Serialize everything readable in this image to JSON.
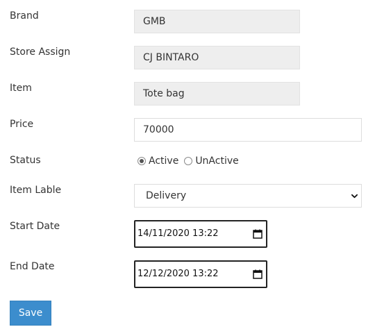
{
  "form": {
    "brand": {
      "label": "Brand",
      "value": "GMB"
    },
    "store_assign": {
      "label": "Store Assign",
      "value": "CJ BINTARO"
    },
    "item": {
      "label": "Item",
      "value": "Tote bag"
    },
    "price": {
      "label": "Price",
      "value": "70000"
    },
    "status": {
      "label": "Status",
      "options": [
        {
          "label": "Active",
          "checked": true
        },
        {
          "label": "UnActive",
          "checked": false
        }
      ]
    },
    "item_lable": {
      "label": "Item Lable",
      "value": "Delivery"
    },
    "start_date": {
      "label": "Start Date",
      "value": "14/11/2020 13:22"
    },
    "end_date": {
      "label": "End Date",
      "value": "12/12/2020 13:22"
    },
    "save_label": "Save"
  },
  "colors": {
    "readonly_bg": "#eeeeee",
    "button_bg": "#3c8dcd",
    "text": "#333333"
  }
}
